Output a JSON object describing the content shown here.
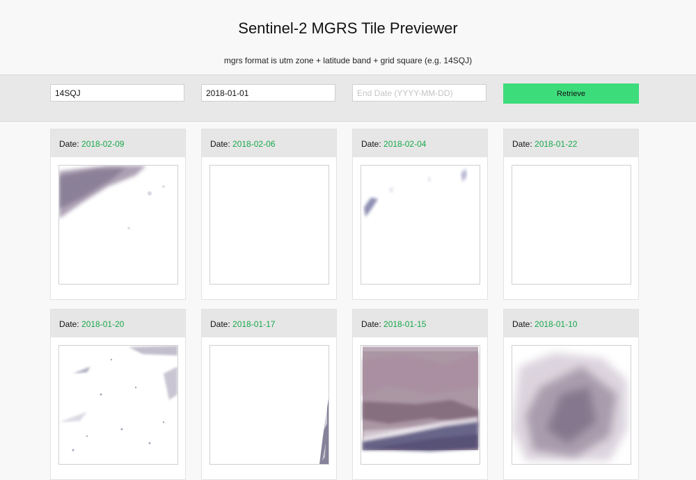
{
  "page": {
    "title": "Sentinel-2 MGRS Tile Previewer",
    "subtitle": "mgrs format is utm zone + latitude band + grid square (e.g. 14SQJ)"
  },
  "form": {
    "mgrs_value": "14SQJ",
    "start_date_value": "2018-01-01",
    "end_date_placeholder": "End Date (YYYY-MM-DD)",
    "retrieve_label": "Retrieve"
  },
  "colors": {
    "accent_green": "#3ddc7b",
    "date_green": "#17a84a"
  },
  "tiles": [
    {
      "label": "Date:",
      "date": "2018-02-09",
      "preview": "cloud-streak-top-left"
    },
    {
      "label": "Date:",
      "date": "2018-02-06",
      "preview": "blank"
    },
    {
      "label": "Date:",
      "date": "2018-02-04",
      "preview": "small-wisps"
    },
    {
      "label": "Date:",
      "date": "2018-01-22",
      "preview": "blank"
    },
    {
      "label": "Date:",
      "date": "2018-01-20",
      "preview": "sparse-speckle"
    },
    {
      "label": "Date:",
      "date": "2018-01-17",
      "preview": "edge-sliver"
    },
    {
      "label": "Date:",
      "date": "2018-01-15",
      "preview": "dense-terrain"
    },
    {
      "label": "Date:",
      "date": "2018-01-10",
      "preview": "large-cloud"
    }
  ]
}
